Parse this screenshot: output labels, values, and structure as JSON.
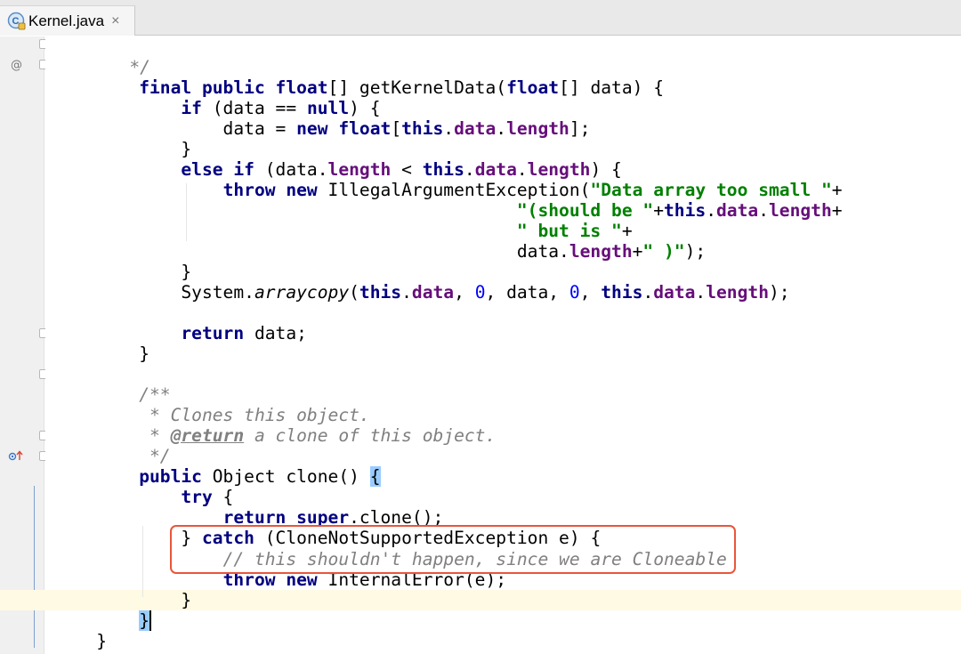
{
  "tab": {
    "filename": "Kernel.java",
    "close_glyph": "×",
    "icon": "java-class-icon"
  },
  "gutter": {
    "override_marker": "@",
    "implements_marker": "↑"
  },
  "code": {
    "l0": {
      "t1": "    */"
    },
    "l1": {
      "t1": "final",
      "t2": " ",
      "t3": "public",
      "t4": " ",
      "t5": "float",
      "t6": "[] getKernelData(",
      "t7": "float",
      "t8": "[] data) {"
    },
    "l2": {
      "t1": "    ",
      "t2": "if",
      "t3": " (data == ",
      "t4": "null",
      "t5": ") {"
    },
    "l3": {
      "t1": "        data = ",
      "t2": "new",
      "t3": " ",
      "t4": "float",
      "t5": "[",
      "t6": "this",
      "t7": ".",
      "t8": "data",
      "t9": ".",
      "t10": "length",
      "t11": "];"
    },
    "l4": {
      "t1": "    }"
    },
    "l5": {
      "t1": "    ",
      "t2": "else",
      "t3": " ",
      "t4": "if",
      "t5": " (data.",
      "t6": "length",
      "t7": " < ",
      "t8": "this",
      "t9": ".",
      "t10": "data",
      "t11": ".",
      "t12": "length",
      "t13": ") {"
    },
    "l6": {
      "t1": "        ",
      "t2": "throw",
      "t3": " ",
      "t4": "new",
      "t5": " IllegalArgumentException(",
      "t6": "\"Data array too small \"",
      "t7": "+"
    },
    "l7": {
      "t1": "                                    ",
      "t2": "\"(should be \"",
      "t3": "+",
      "t4": "this",
      "t5": ".",
      "t6": "data",
      "t7": ".",
      "t8": "length",
      "t9": "+"
    },
    "l8": {
      "t1": "                                    ",
      "t2": "\" but is \"",
      "t3": "+"
    },
    "l9": {
      "t1": "                                    data.",
      "t2": "length",
      "t3": "+",
      "t4": "\" )\"",
      "t5": ");"
    },
    "l10": {
      "t1": "    }"
    },
    "l11": {
      "t1": "    System.",
      "t2": "arraycopy",
      "t3": "(",
      "t4": "this",
      "t5": ".",
      "t6": "data",
      "t7": ", ",
      "t8": "0",
      "t9": ", data, ",
      "t10": "0",
      "t11": ", ",
      "t12": "this",
      "t13": ".",
      "t14": "data",
      "t15": ".",
      "t16": "length",
      "t17": ");"
    },
    "l13": {
      "t1": "    ",
      "t2": "return",
      "t3": " data;"
    },
    "l14": {
      "t1": "}"
    },
    "l16": {
      "t1": "/**"
    },
    "l17": {
      "t1": " * Clones this object."
    },
    "l18": {
      "t1": " * ",
      "t2": "@return",
      "t3": " a clone of this object."
    },
    "l19": {
      "t1": " */"
    },
    "l20": {
      "t1": "public",
      "t2": " Object clone() ",
      "t3": "{"
    },
    "l21": {
      "t1": "    ",
      "t2": "try",
      "t3": " {"
    },
    "l22": {
      "t1": "        ",
      "t2": "return",
      "t3": " ",
      "t4": "super",
      "t5": ".clone();"
    },
    "l23": {
      "t1": "    } ",
      "t2": "catch",
      "t3": " (CloneNotSupportedException e) {"
    },
    "l24": {
      "t1": "        ",
      "t2": "// this shouldn't happen, since we are Cloneable"
    },
    "l25": {
      "t1": "        ",
      "t2": "throw",
      "t3": " ",
      "t4": "new",
      "t5": " InternalError(e);"
    },
    "l26": {
      "t1": "    }"
    },
    "l27": {
      "t1": "}"
    },
    "l28": {
      "t1": "}"
    }
  },
  "colors": {
    "keyword": "#000080",
    "string": "#008000",
    "field": "#660e7a",
    "number": "#0000ff",
    "comment": "#808080",
    "highlight_box": "#e8563b",
    "caret_line": "#fffae3"
  }
}
